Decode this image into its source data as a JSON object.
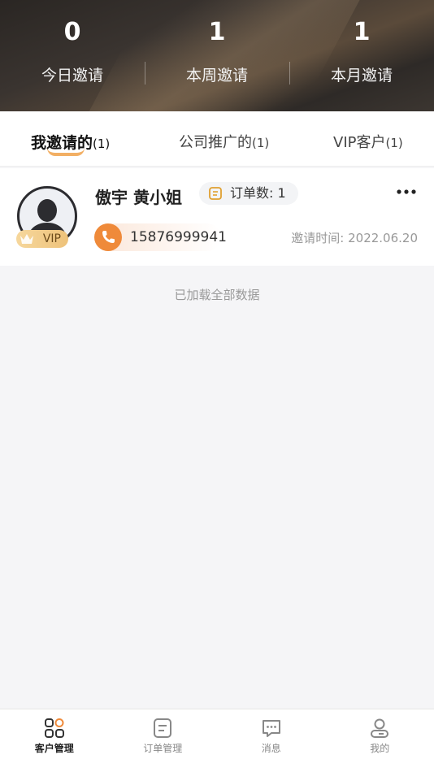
{
  "stats": [
    {
      "value": "0",
      "label": "今日邀请"
    },
    {
      "value": "1",
      "label": "本周邀请"
    },
    {
      "value": "1",
      "label": "本月邀请"
    }
  ],
  "tabs": [
    {
      "label": "我邀请的",
      "count": "(1)",
      "active": true
    },
    {
      "label": "公司推广的",
      "count": "(1)",
      "active": false
    },
    {
      "label": "VIP客户",
      "count": "(1)",
      "active": false
    }
  ],
  "customer": {
    "name": "傲宇 黄小姐",
    "badge": "VIP",
    "order_label": "订单数: 1",
    "phone": "15876999941",
    "invite_time": "邀请时间: 2022.06.20"
  },
  "list_footer": "已加载全部数据",
  "nav": [
    {
      "label": "客户管理",
      "icon": "grid-icon",
      "active": true
    },
    {
      "label": "订单管理",
      "icon": "order-icon",
      "active": false
    },
    {
      "label": "消息",
      "icon": "message-icon",
      "active": false
    },
    {
      "label": "我的",
      "icon": "profile-icon",
      "active": false
    }
  ],
  "colors": {
    "accent": "#ef8a3a",
    "vip_gold": "#eec27a",
    "header_dark": "#2e2a27"
  }
}
